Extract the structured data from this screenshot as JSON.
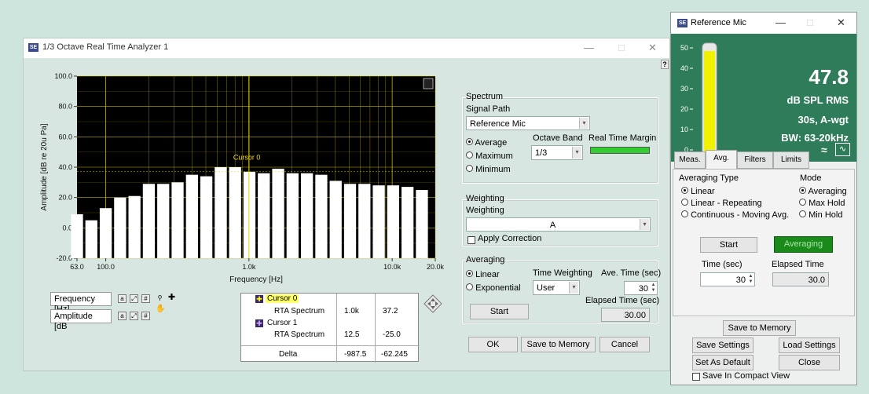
{
  "rta": {
    "title": "1/3 Octave Real Time Analyzer 1",
    "logo": "SE",
    "help": "?",
    "window_controls": {
      "minimize": "—",
      "maximize": "□",
      "close": "✕"
    },
    "plot_corner_icon": "graph-options-icon"
  },
  "chart_data": {
    "type": "bar",
    "xlabel": "Frequency [Hz]",
    "ylabel": "Amplitude [dB re 20u Pa]",
    "ylim": [
      -20,
      100
    ],
    "x_scale": "log",
    "xlim": [
      63,
      20000
    ],
    "y_ticks": [
      "100.0",
      "80.0",
      "60.0",
      "40.0",
      "20.0",
      "0.0",
      "-20.0"
    ],
    "x_ticks": [
      "63.0",
      "100.0",
      "1.0k",
      "10.0k",
      "20.0k"
    ],
    "x_tick_values": [
      63,
      100,
      1000,
      10000,
      20000
    ],
    "grid": true,
    "background": "#000000",
    "bar_color": "#ffffff",
    "grid_color": "#c9b300",
    "cursor_label": "Cursor 0",
    "cursor_x": 1000,
    "categories": [
      "63",
      "80",
      "100",
      "125",
      "160",
      "200",
      "250",
      "315",
      "400",
      "500",
      "630",
      "800",
      "1k",
      "1.25k",
      "1.6k",
      "2k",
      "2.5k",
      "3.15k",
      "4k",
      "5k",
      "6.3k",
      "8k",
      "10k",
      "12.5k",
      "16k"
    ],
    "values": [
      9,
      5,
      13,
      20,
      21,
      29,
      29,
      30,
      35,
      34,
      40,
      40,
      37,
      36,
      39,
      36,
      36,
      35,
      31,
      29,
      29,
      28,
      28,
      27,
      25
    ]
  },
  "scale_legend": {
    "x_name": "Frequency [Hz]",
    "y_name": "Amplitude [dB"
  },
  "cursor_legend": {
    "rows": [
      {
        "name": "Cursor 0",
        "plot": "RTA Spectrum",
        "x": "1.0k",
        "y": "37.2"
      },
      {
        "name": "Cursor 1",
        "plot": "RTA Spectrum",
        "x": "12.5",
        "y": "-25.0"
      }
    ],
    "delta_label": "Delta",
    "delta_x": "-987.5",
    "delta_y": "-62.245"
  },
  "spectrum": {
    "title": "Spectrum",
    "signal_path_label": "Signal Path",
    "signal_path_value": "Reference Mic",
    "modes": [
      "Average",
      "Maximum",
      "Minimum"
    ],
    "selected_mode": "Average",
    "octave_band_label": "Octave Band",
    "octave_band_value": "1/3",
    "real_time_margin_label": "Real Time Margin",
    "margin_color": "#33cc33"
  },
  "weighting": {
    "title": "Weighting",
    "label": "Weighting",
    "value": "A",
    "apply_correction_label": "Apply Correction",
    "apply_correction_checked": false
  },
  "averaging": {
    "title": "Averaging",
    "types": [
      "Linear",
      "Exponential"
    ],
    "selected_type": "Linear",
    "time_weighting_label": "Time Weighting",
    "time_weighting_value": "User",
    "ave_time_label": "Ave. Time (sec)",
    "ave_time_value": "30",
    "elapsed_time_label": "Elapsed Time (sec)",
    "elapsed_time_value": "30.00",
    "start_label": "Start"
  },
  "dialog_buttons": {
    "ok": "OK",
    "save_to_memory": "Save to Memory",
    "cancel": "Cancel"
  },
  "mic": {
    "title": "Reference Mic",
    "logo": "SE",
    "value": "47.8",
    "unit": "dB SPL RMS",
    "time_weight": "30s, A-wgt",
    "bandwidth": "BW: 63-20kHz",
    "meter_ticks": [
      "50",
      "40",
      "30",
      "20",
      "10",
      "0"
    ],
    "meter_level": 0.956,
    "meter_color": "#f2f200",
    "tabs": [
      "Meas.",
      "Avg.",
      "Filters",
      "Limits"
    ],
    "active_tab": "Avg.",
    "averaging_type_label": "Averaging Type",
    "averaging_types": [
      "Linear",
      "Linear - Repeating",
      "Continuous - Moving Avg."
    ],
    "selected_averaging_type": "Linear",
    "mode_label": "Mode",
    "modes": [
      "Averaging",
      "Max Hold",
      "Min Hold"
    ],
    "selected_mode": "Averaging",
    "start_label": "Start",
    "status_label": "Averaging",
    "status_color": "#1a8a1a",
    "time_label": "Time (sec)",
    "time_value": "30",
    "elapsed_label": "Elapsed Time",
    "elapsed_value": "30.0",
    "save_to_memory": "Save to Memory",
    "save_settings": "Save Settings",
    "load_settings": "Load Settings",
    "set_as_default": "Set As Default",
    "close": "Close",
    "compact_view_label": "Save In Compact View",
    "compact_view_checked": false
  }
}
